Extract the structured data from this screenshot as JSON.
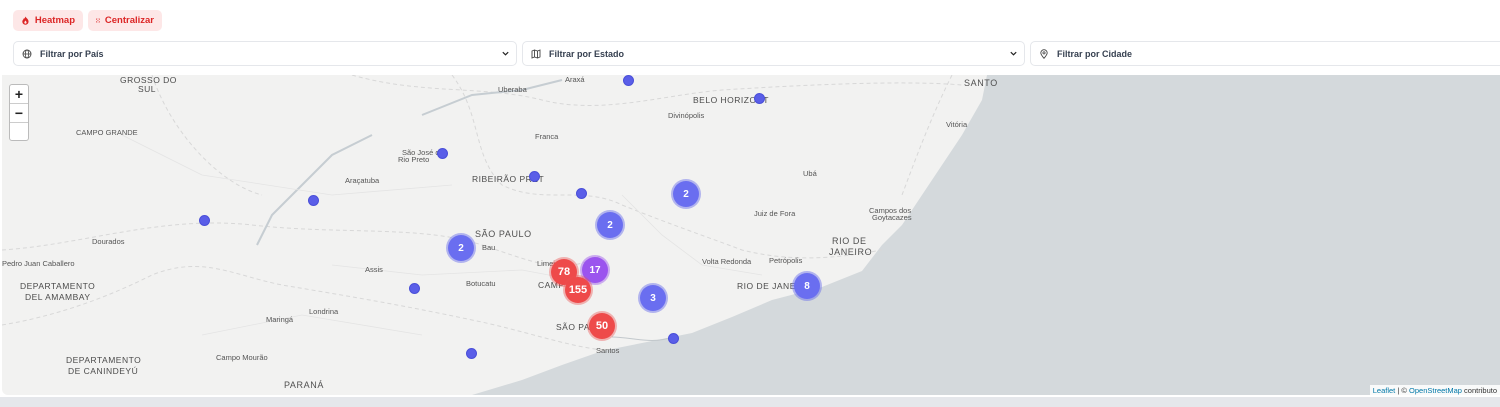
{
  "toolbar": {
    "heatmap_label": "Heatmap",
    "center_label": "Centralizar"
  },
  "filters": {
    "country": "Filtrar por País",
    "state": "Filtrar por Estado",
    "city": "Filtrar por Cidade"
  },
  "zoom": {
    "in": "+",
    "out": "−"
  },
  "map_labels": {
    "grosso": "GROSSO DO",
    "sul": "SUL",
    "uberaba": "Uberaba",
    "araxa": "Araxá",
    "belo": "BELO HORIZONT",
    "santo": "SANTO",
    "divinopolis": "Divinópolis",
    "vitoria": "Vitória",
    "campo_grande": "CAMPO GRANDE",
    "franca": "Franca",
    "sjrp1": "São José do",
    "sjrp2": "Rio Preto",
    "aracatuba": "Araçatuba",
    "ribeirao": "RIBEIRÃO PRET",
    "uba": "Ubá",
    "juiz": "Juiz de Fora",
    "campos1": "Campos dos",
    "campos2": "Goytacazes",
    "dourados": "Dourados",
    "sao_paulo_st": "SÃO PAULO",
    "bauru": "Bau",
    "rio_st1": "RIO DE",
    "rio_st2": "JANEIRO",
    "pedro": "Pedro Juan Caballero",
    "limeira": "Limei",
    "volta": "Volta Redonda",
    "petropolis": "Petrópolis",
    "assis": "Assis",
    "botucatu": "Botucatu",
    "campinas": "CAMP",
    "rio_city": "RIO DE JANEIRO",
    "amambay1": "DEPARTAMENTO",
    "amambay2": "DEL AMAMBAY",
    "maringa": "Maringá",
    "londrina": "Londrina",
    "sao_paulo_city": "SÃO PAUL",
    "santos": "Santos",
    "canindeyu1": "DEPARTAMENTO",
    "canindeyu2": "DE CANINDEYÚ",
    "campo_mourao": "Campo Mourão",
    "parana": "PARANÁ"
  },
  "clusters": {
    "c1": "2",
    "c2": "2",
    "c3": "2",
    "c4": "78",
    "c5": "17",
    "c6": "155",
    "c7": "3",
    "c8": "8",
    "c9": "50"
  },
  "attribution": {
    "leaflet": "Leaflet",
    "sep": " | © ",
    "osm": "OpenStreetMap",
    "rest": " contributo"
  },
  "colors": {
    "accent": "#dc2626",
    "marker": "#5a5ee8",
    "cluster_red": "#ee4a4a",
    "cluster_purple": "#9b54ee",
    "water": "#d4d9dc"
  }
}
